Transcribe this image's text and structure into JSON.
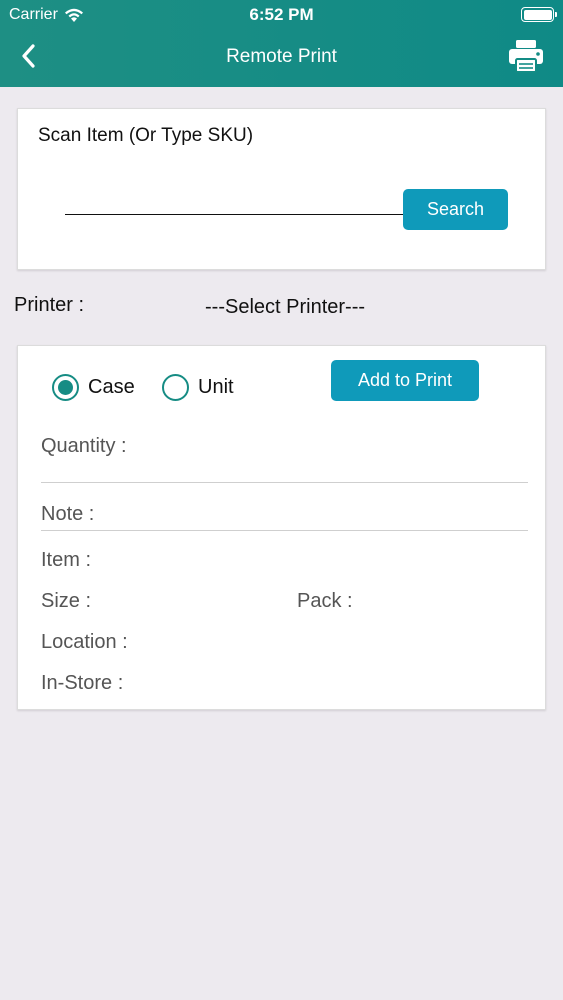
{
  "status_bar": {
    "carrier": "Carrier",
    "time": "6:52 PM"
  },
  "header": {
    "title": "Remote Print",
    "back_icon": "chevron-left-icon",
    "print_icon": "printer-icon",
    "background": "#138c85"
  },
  "scan": {
    "label": "Scan Item (Or Type SKU)",
    "input_value": "",
    "search_label": "Search"
  },
  "printer": {
    "label": "Printer :",
    "selected": "---Select Printer---"
  },
  "details": {
    "radio_case_label": "Case",
    "radio_unit_label": "Unit",
    "selected_option": "Case",
    "add_label": "Add to Print",
    "quantity_label": "Quantity :",
    "note_label": "Note :",
    "item_label": "Item :",
    "size_label": "Size :",
    "pack_label": "Pack :",
    "location_label": "Location :",
    "instore_label": "In-Store :"
  },
  "colors": {
    "accent": "#0f9aba",
    "radio": "#168c84",
    "page_bg": "#edeaef"
  }
}
